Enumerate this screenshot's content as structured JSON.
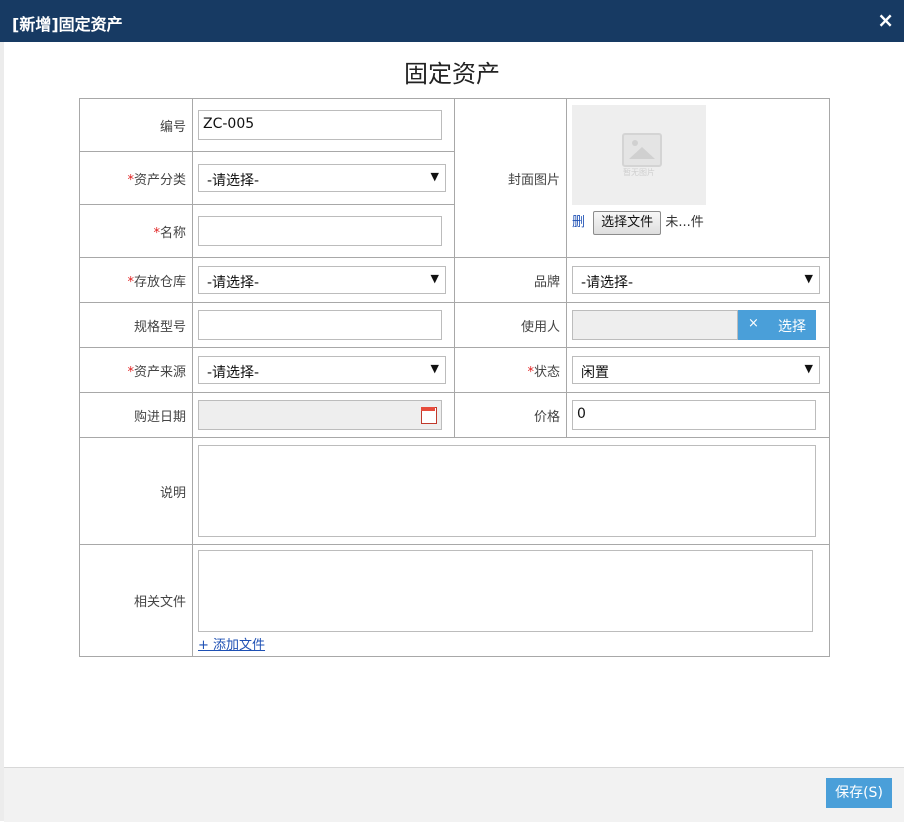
{
  "dialog": {
    "title": "[新增]固定资产",
    "close": "×"
  },
  "form": {
    "title": "固定资产",
    "required_mark": "*",
    "fields": {
      "code": {
        "label": "编号",
        "value": "ZC-005"
      },
      "category": {
        "label": "资产分类",
        "value": "-请选择-"
      },
      "name": {
        "label": "名称",
        "value": ""
      },
      "cover": {
        "label": "封面图片",
        "placeholder_text": "暂无图片",
        "delete": "删",
        "choose_file": "选择文件",
        "file_status": "未...件"
      },
      "warehouse": {
        "label": "存放仓库",
        "value": "-请选择-"
      },
      "brand": {
        "label": "品牌",
        "value": "-请选择-"
      },
      "spec": {
        "label": "规格型号",
        "value": ""
      },
      "user": {
        "label": "使用人",
        "clear": "×",
        "select": "选择"
      },
      "source": {
        "label": "资产来源",
        "value": "-请选择-"
      },
      "status": {
        "label": "状态",
        "value": "闲置"
      },
      "purchase_date": {
        "label": "购进日期",
        "value": ""
      },
      "price": {
        "label": "价格",
        "value": "0"
      },
      "description": {
        "label": "说明"
      },
      "files": {
        "label": "相关文件",
        "add": "+ 添加文件"
      }
    }
  },
  "footer": {
    "save": "保存(S)"
  },
  "colors": {
    "titlebar": "#173a63",
    "accent": "#4a9fd9",
    "required": "#e02020",
    "link": "#1e50b4"
  }
}
